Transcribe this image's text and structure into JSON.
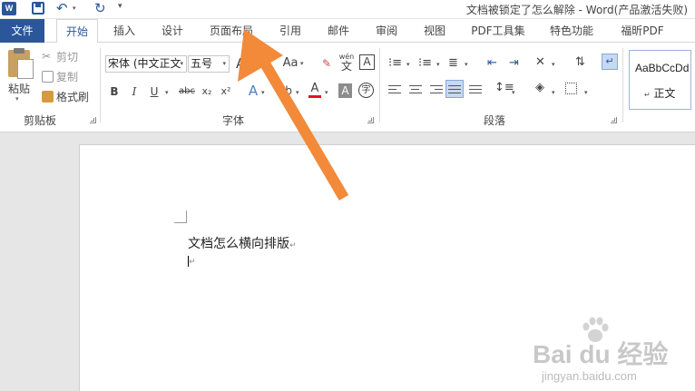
{
  "window": {
    "title": "文档被锁定了怎么解除 - Word(产品激活失败)",
    "app_logo": "W"
  },
  "quick_access": {
    "icons": [
      "word-logo",
      "save-icon",
      "undo-icon",
      "redo-icon",
      "customize-qat-icon"
    ]
  },
  "tabs": {
    "file": "文件",
    "home": "开始",
    "insert": "插入",
    "design": "设计",
    "page_layout": "页面布局",
    "references": "引用",
    "mailings": "邮件",
    "review": "审阅",
    "view": "视图",
    "pdf_tools": "PDF工具集",
    "special": "特色功能",
    "foxit_pdf": "福昕PDF"
  },
  "clipboard": {
    "paste": "粘贴",
    "cut": "剪切",
    "copy": "复制",
    "format_painter": "格式刷",
    "group_label": "剪贴板"
  },
  "font": {
    "font_name": "宋体 (中文正文",
    "font_size": "五号",
    "grow": "A",
    "case": "Aa",
    "phonetic": "wén",
    "phonetic_sub": "文",
    "border_char": "A",
    "bold": "B",
    "italic": "I",
    "underline": "U",
    "strike": "abc",
    "subscript": "x₂",
    "superscript": "x²",
    "effects": "A",
    "font_color": "A",
    "shading": "A",
    "enclose": "字",
    "group_label": "字体"
  },
  "paragraph": {
    "group_label": "段落"
  },
  "styles": {
    "sample": "AaBbCcDd",
    "name": "正文",
    "mark": "↵"
  },
  "document": {
    "line1": "文档怎么横向排版",
    "para_mark": "↵"
  },
  "watermark": {
    "brand": "Bai du 经验",
    "url": "jingyan.baidu.com"
  },
  "colors": {
    "accent": "#2b579a",
    "arrow": "#f28a3a",
    "font_color_bar": "#e81123"
  }
}
